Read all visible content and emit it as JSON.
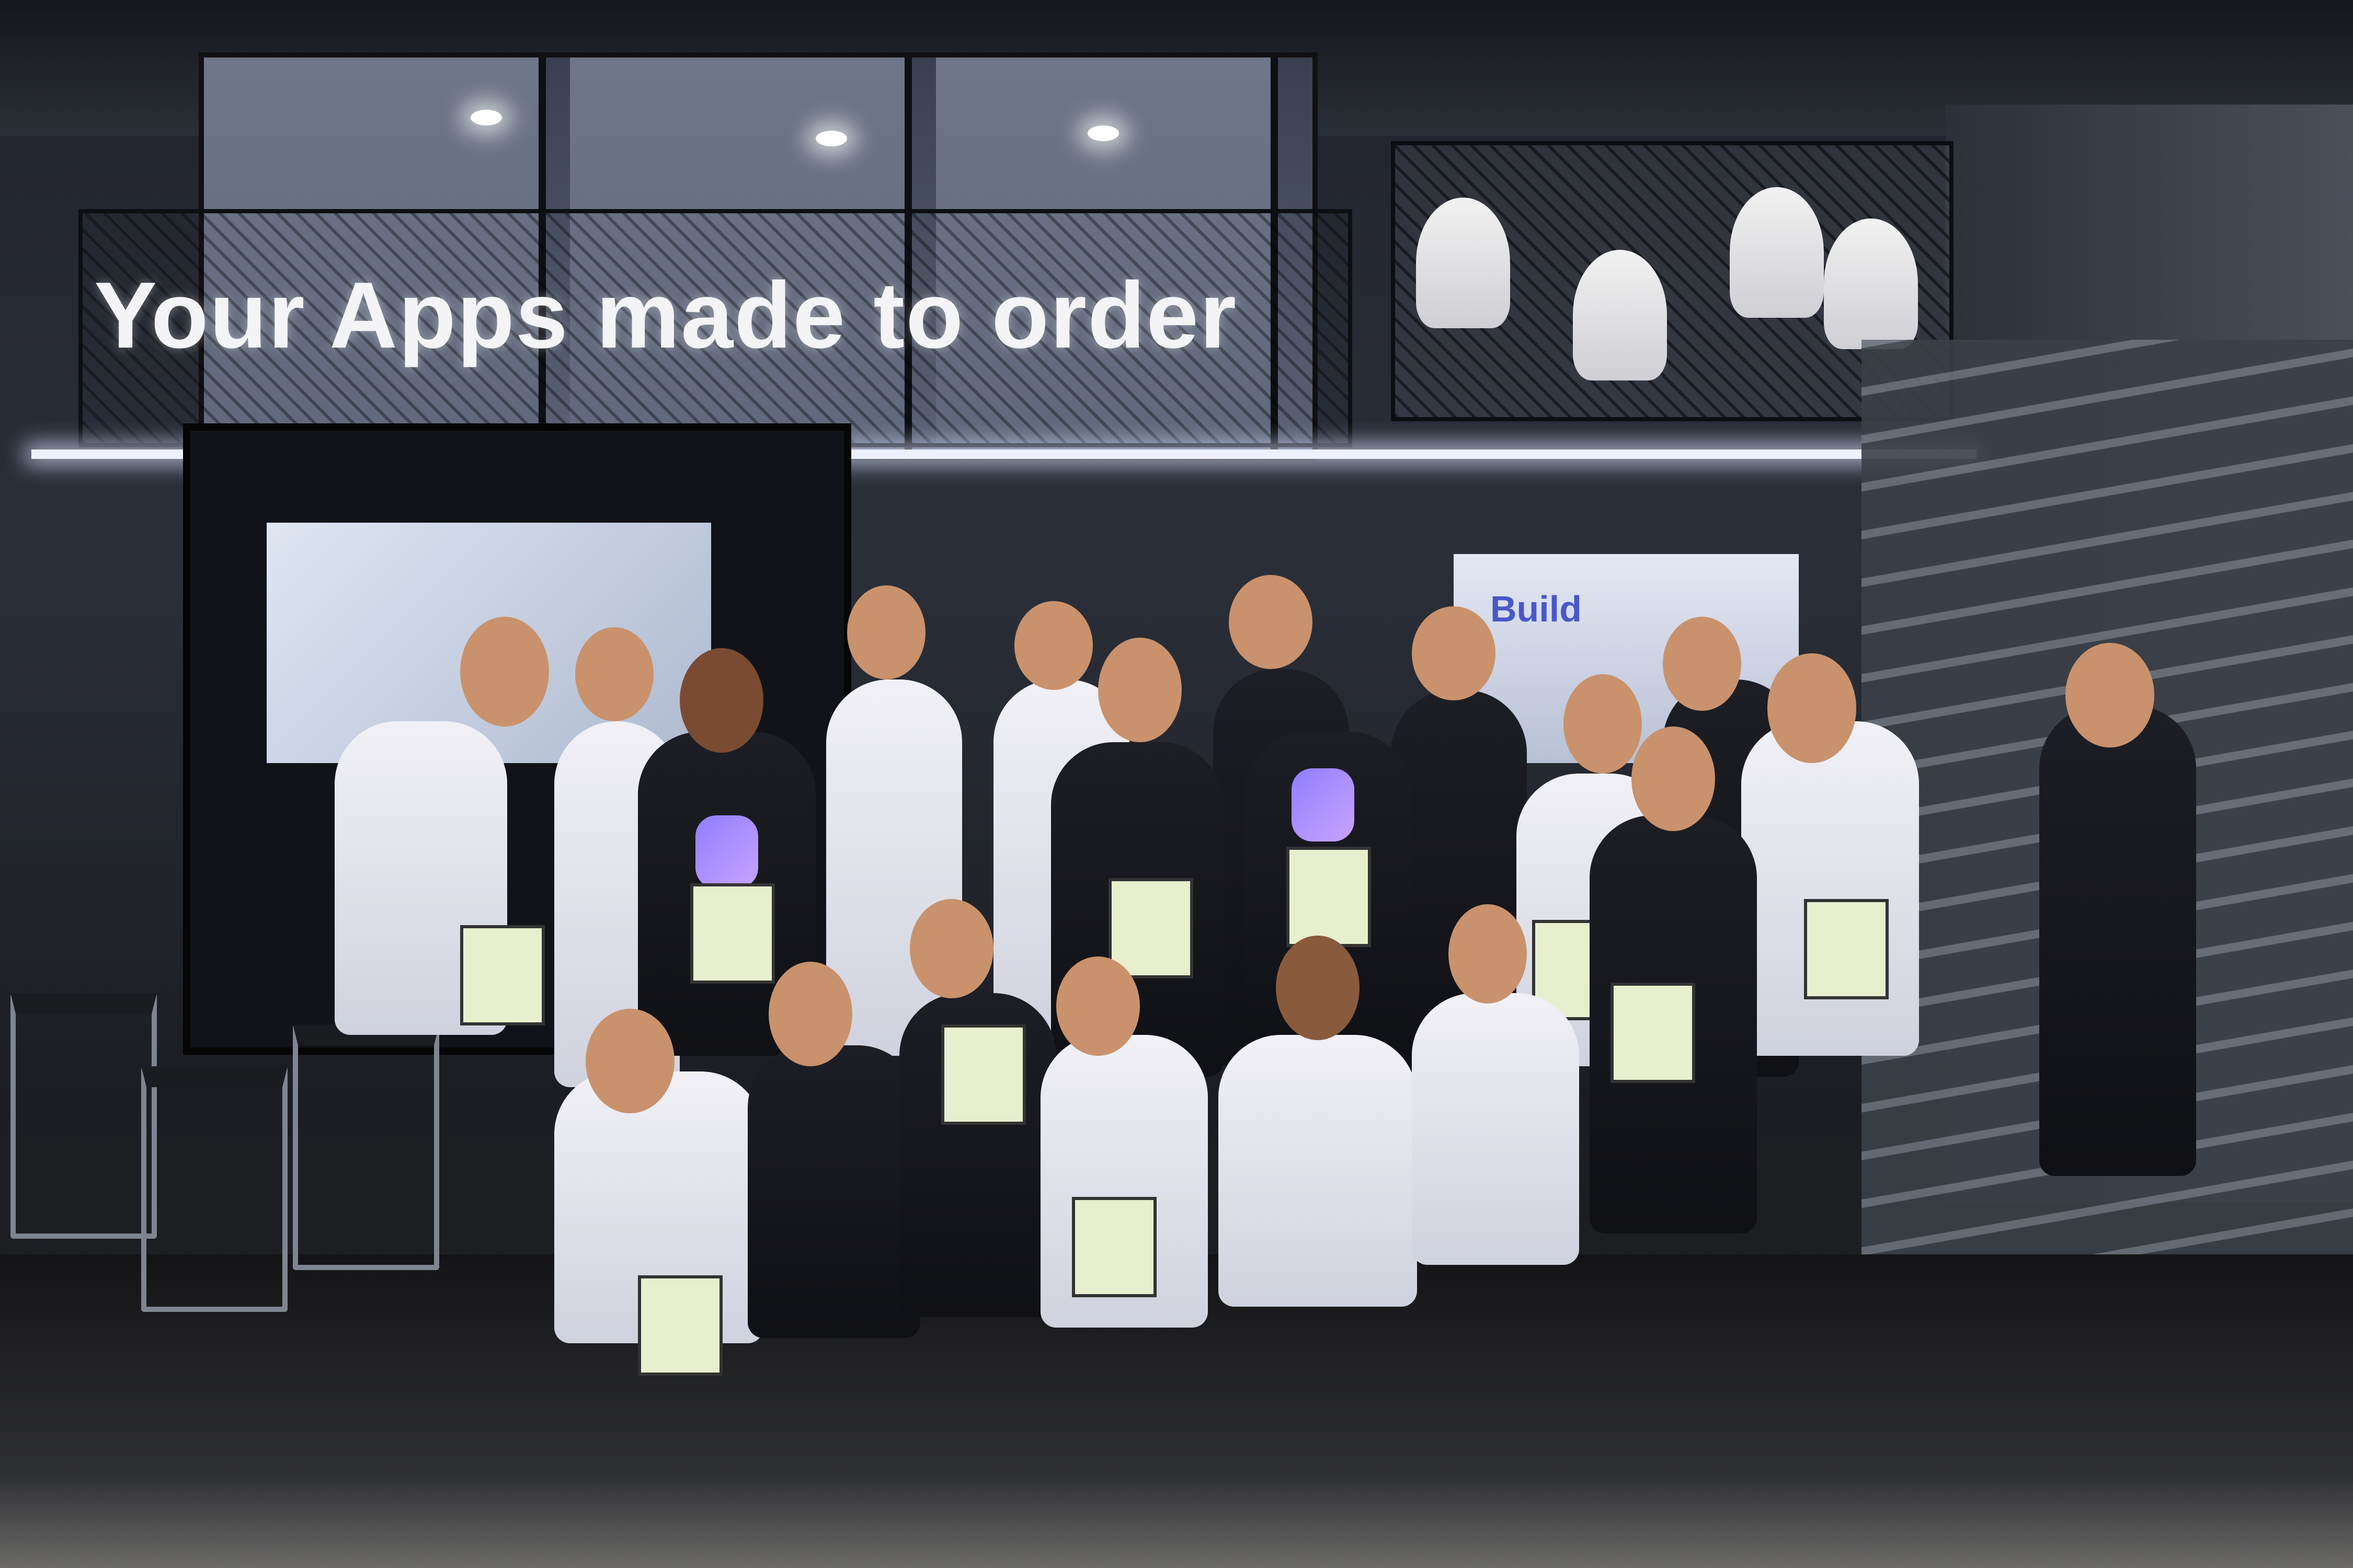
{
  "image": {
    "headline": "Your Apps made to order",
    "back_screen_text": "Build"
  }
}
